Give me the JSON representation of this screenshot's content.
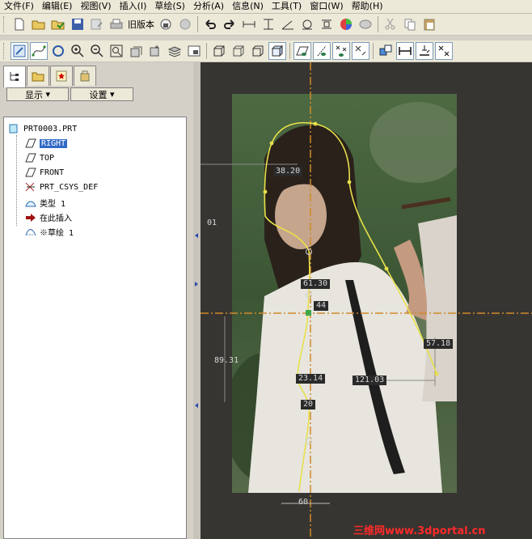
{
  "menu": [
    {
      "label": "文件(F)"
    },
    {
      "label": "编辑(E)"
    },
    {
      "label": "视图(V)"
    },
    {
      "label": "插入(I)"
    },
    {
      "label": "草绘(S)"
    },
    {
      "label": "分析(A)"
    },
    {
      "label": "信息(N)"
    },
    {
      "label": "工具(T)"
    },
    {
      "label": "窗口(W)"
    },
    {
      "label": "帮助(H)"
    }
  ],
  "toolbar": {
    "old_version_label": "旧版本"
  },
  "panel": {
    "display_btn": "显示",
    "settings_btn": "设置"
  },
  "tree": {
    "root": "PRT0003.PRT",
    "items": [
      {
        "label": "RIGHT",
        "icon": "datum-plane-icon"
      },
      {
        "label": "TOP",
        "icon": "datum-plane-icon"
      },
      {
        "label": "FRONT",
        "icon": "datum-plane-icon"
      },
      {
        "label": "PRT_CSYS_DEF",
        "icon": "csys-icon"
      },
      {
        "label": "类型 1",
        "icon": "feature-icon"
      },
      {
        "label": "在此插入",
        "icon": "insert-here-arrow-icon"
      },
      {
        "label": "※草绘 1",
        "icon": "sketch-icon"
      }
    ]
  },
  "dimensions": [
    {
      "text": "38.20"
    },
    {
      "text": "01"
    },
    {
      "text": "61.30"
    },
    {
      "text": "44"
    },
    {
      "text": "89.31"
    },
    {
      "text": "57.18"
    },
    {
      "text": "23.14"
    },
    {
      "text": "121.03"
    },
    {
      "text": "20"
    },
    {
      "text": "60"
    }
  ],
  "watermark": "三维网www.3dportal.cn",
  "colors": {
    "viewport_bg": "#373531",
    "sketch_yellow": "#e8e04a",
    "axis_orange": "#d08a2a",
    "selection": "#316ac5"
  }
}
